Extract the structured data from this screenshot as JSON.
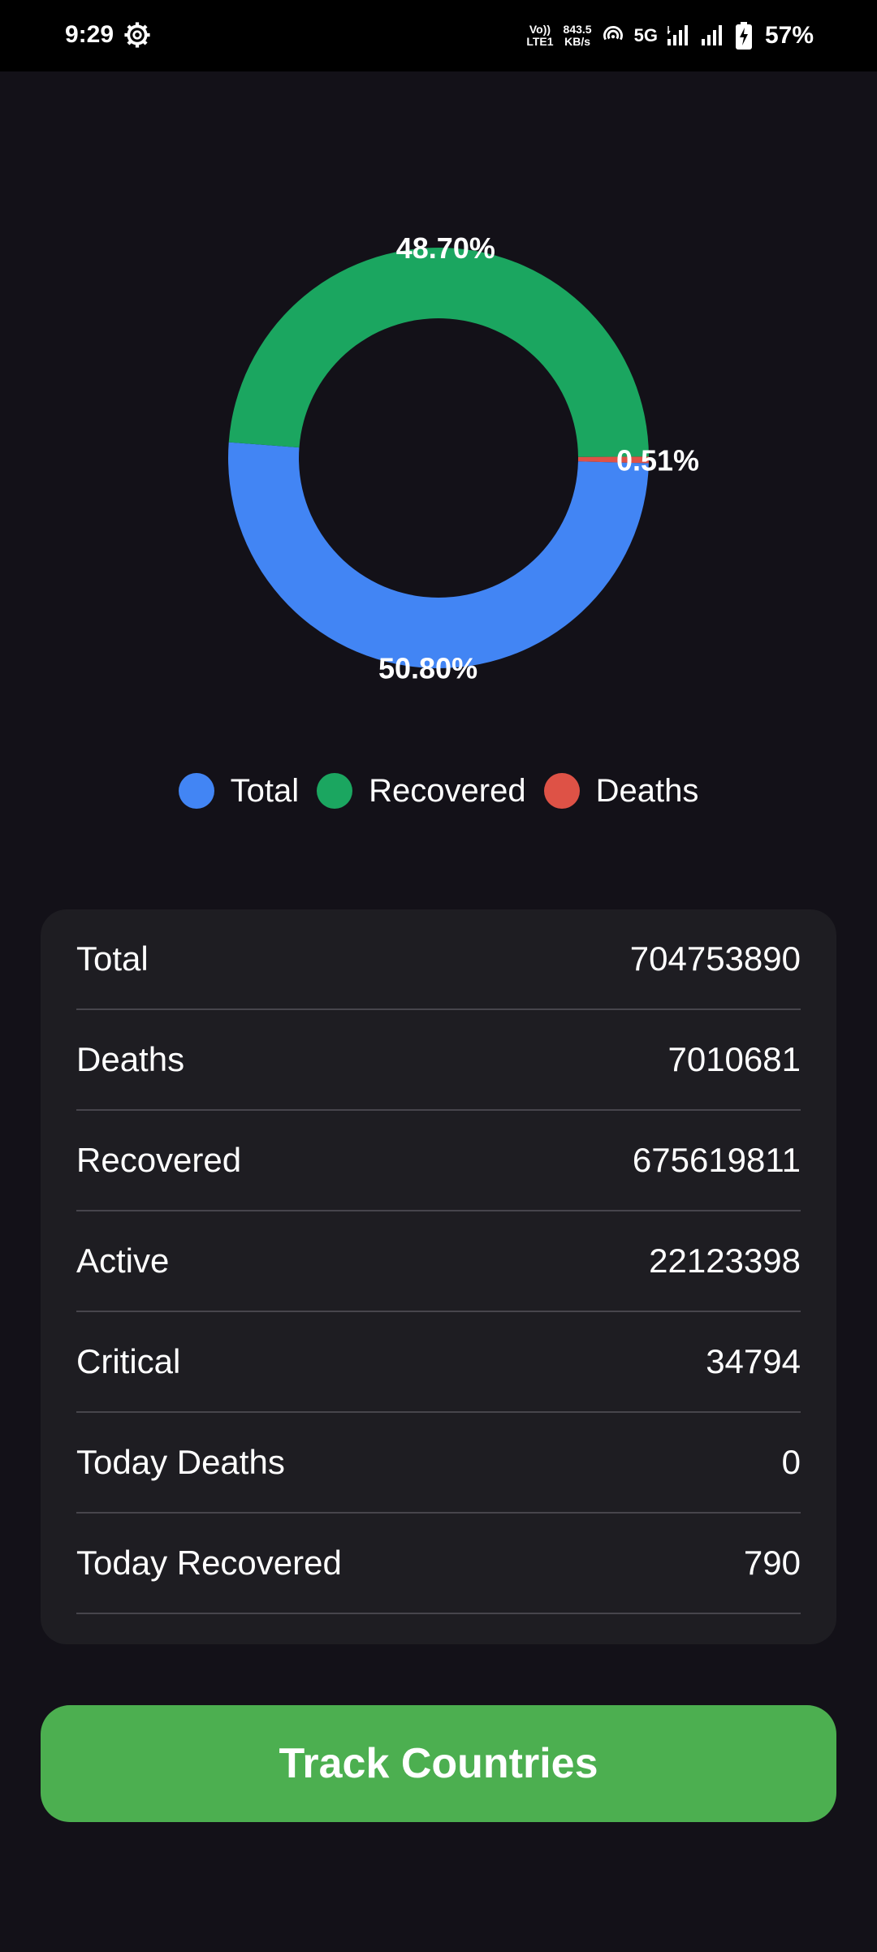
{
  "status_bar": {
    "time": "9:29",
    "volte_line1": "Vo))",
    "volte_line2": "LTE1",
    "speed_line1": "843.5",
    "speed_line2": "KB/s",
    "network": "5G",
    "battery": "57%",
    "icons": [
      "settings-icon",
      "hotspot-icon",
      "signal-icon",
      "signal-icon",
      "battery-charging-icon"
    ]
  },
  "chart_data": {
    "type": "pie",
    "donut": true,
    "slices": [
      {
        "name": "Total",
        "value": 50.8,
        "label": "50.80%",
        "color": "#4285f4"
      },
      {
        "name": "Recovered",
        "value": 48.7,
        "label": "48.70%",
        "color": "#1ba660"
      },
      {
        "name": "Deaths",
        "value": 0.51,
        "label": "0.51%",
        "color": "#de5246"
      }
    ],
    "legend_position": "bottom"
  },
  "stats": {
    "rows": [
      {
        "label": "Total",
        "value": "704753890"
      },
      {
        "label": "Deaths",
        "value": "7010681"
      },
      {
        "label": "Recovered",
        "value": "675619811"
      },
      {
        "label": "Active",
        "value": "22123398"
      },
      {
        "label": "Critical",
        "value": "34794"
      },
      {
        "label": "Today Deaths",
        "value": "0"
      },
      {
        "label": "Today Recovered",
        "value": "790"
      }
    ]
  },
  "button": {
    "label": "Track Countries",
    "color": "#4caf50"
  }
}
